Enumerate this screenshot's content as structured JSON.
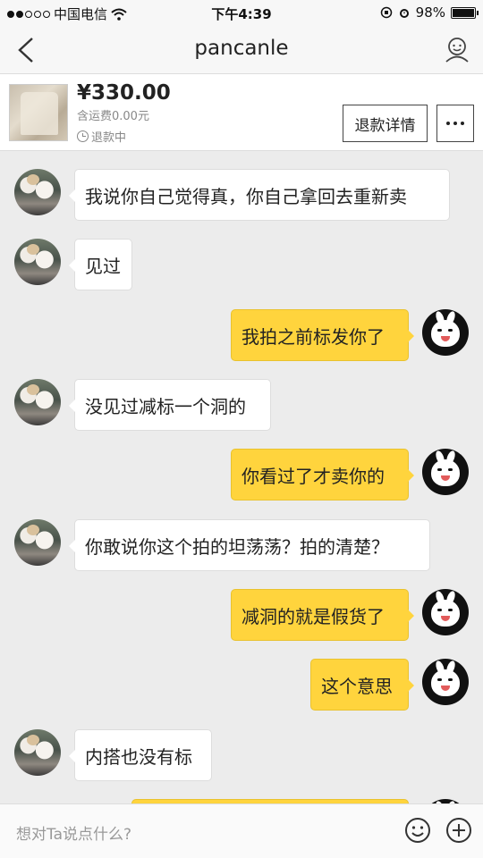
{
  "status_bar": {
    "carrier": "中国电信",
    "time": "下午4:39",
    "battery": "98%"
  },
  "nav": {
    "title": "pancanle",
    "back_icon": "chevron-left-icon",
    "profile_icon": "user-profile-icon"
  },
  "product": {
    "price": "¥330.00",
    "shipping": "含运费0.00元",
    "status": "退款中",
    "refund_button": "退款详情",
    "more_icon": "more-dots-icon"
  },
  "messages": [
    {
      "side": "in",
      "text": "我说你自己觉得真，你自己拿回去重新卖"
    },
    {
      "side": "in",
      "text": "见过"
    },
    {
      "side": "out",
      "text": "我拍之前标发你了"
    },
    {
      "side": "in",
      "text": "没见过减标一个洞的"
    },
    {
      "side": "out",
      "text": "你看过了才卖你的"
    },
    {
      "side": "in",
      "text": "你敢说你这个拍的坦荡荡？拍的清楚？"
    },
    {
      "side": "out",
      "text": "减洞的就是假货了"
    },
    {
      "side": "out",
      "text": "这个意思"
    },
    {
      "side": "in",
      "text": "内搭也没有标"
    },
    {
      "side": "out",
      "text": ""
    }
  ],
  "input": {
    "placeholder": "想对Ta说点什么?",
    "emoji_icon": "emoji-icon",
    "plus_icon": "plus-icon"
  }
}
